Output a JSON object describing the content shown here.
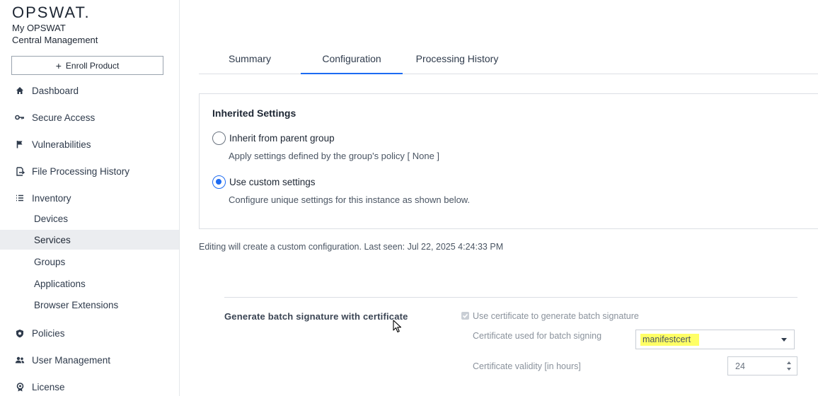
{
  "brand": {
    "logo": "OPSWAT.",
    "app_line1": "My OPSWAT",
    "app_line2": "Central Management"
  },
  "sidebar": {
    "enroll_label": "Enroll Product",
    "items": [
      {
        "label": "Dashboard",
        "icon": "home-icon"
      },
      {
        "label": "Secure Access",
        "icon": "key-icon"
      },
      {
        "label": "Vulnerabilities",
        "icon": "flag-icon"
      },
      {
        "label": "File Processing History",
        "icon": "file-processing-icon"
      },
      {
        "label": "Inventory",
        "icon": "list-icon"
      }
    ],
    "sub_items": [
      {
        "label": "Devices"
      },
      {
        "label": "Services",
        "active": true
      },
      {
        "label": "Groups"
      },
      {
        "label": "Applications"
      },
      {
        "label": "Browser Extensions"
      }
    ],
    "items_after": [
      {
        "label": "Policies",
        "icon": "shield-icon"
      },
      {
        "label": "User Management",
        "icon": "users-icon"
      },
      {
        "label": "License",
        "icon": "badge-icon"
      }
    ]
  },
  "tabs": [
    {
      "label": "Summary",
      "active": false
    },
    {
      "label": "Configuration",
      "active": true
    },
    {
      "label": "Processing History",
      "active": false
    }
  ],
  "inherited": {
    "title": "Inherited Settings",
    "option_inherit_label": "Inherit from parent group",
    "option_inherit_desc": "Apply settings defined by the group's policy [ None ]",
    "option_custom_label": "Use custom settings",
    "option_custom_desc": "Configure unique settings for this instance as shown below.",
    "selected": "custom"
  },
  "edit_note": "Editing will create a custom configuration. Last seen: Jul 22, 2025 4:24:33 PM",
  "batch": {
    "section_label": "Generate batch signature with certificate",
    "checkbox_label": "Use certificate to generate batch signature",
    "checkbox_checked": true,
    "cert_label": "Certificate used for batch signing",
    "cert_value": "manifestcert",
    "validity_label": "Certificate validity [in hours]",
    "validity_value": "24"
  },
  "colors": {
    "accent": "#1d6bf2",
    "highlight": "#ffff66"
  }
}
